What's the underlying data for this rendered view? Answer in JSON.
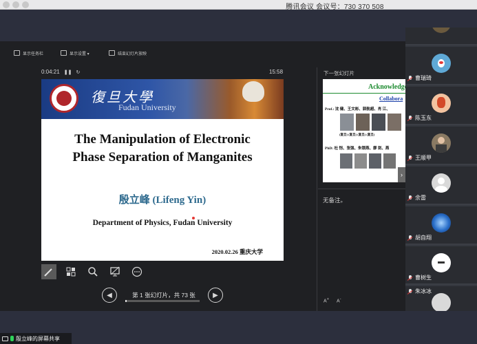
{
  "window": {
    "title": "腾讯会议 会议号：730 370 508"
  },
  "presenter": {
    "toolbar": {
      "show_taskbar": "显示任务栏",
      "display_settings": "显示设置 ▾",
      "end_slideshow": "结束幻灯片放映"
    },
    "elapsed_time": "0:04:21",
    "clock": "15:58",
    "next_slide_label": "下一张幻灯片",
    "notes": "无备注。",
    "font_increase": "A",
    "font_decrease": "A",
    "nav": {
      "slide_counter": "第 1 张幻灯片，共 73 张",
      "current": 1,
      "total": 73
    }
  },
  "slide": {
    "university_cn": "復旦大學",
    "university_en": "Fudan University",
    "title_line1": "The Manipulation of Electronic",
    "title_line2": "Phase Separation of Manganites",
    "author": "殷立峰 (Lifeng Yin)",
    "department": "Department of Physics, Fudan University",
    "date": "2020.02.26 重庆大学"
  },
  "next_slide": {
    "title": "Acknowledge",
    "subtitle": "Collabora",
    "prof_line": "Prof.: 沈 健、王文彬、郭航超、肖 江、",
    "prof_affiliations": "(复旦)   (复旦)   (复旦)   (复旦)",
    "phd_line": "PhD: 杜 恺、张强、朱银燕、廖 剑、燕"
  },
  "participants": [
    {
      "name": "",
      "avatar": "flower-photo"
    },
    {
      "name": "曹瑞琦",
      "avatar": "penguin-photo"
    },
    {
      "name": "陈玉东",
      "avatar": "cartoon-photo"
    },
    {
      "name": "王顺甲",
      "avatar": "person-photo"
    },
    {
      "name": "余雷",
      "avatar": "default-avatar"
    },
    {
      "name": "胡自翔",
      "avatar": "blue-photo"
    },
    {
      "name": "曹树生",
      "avatar": "logo-photo"
    },
    {
      "name": "朱冰冰",
      "avatar": "default-avatar"
    }
  ],
  "share_status": "殷立峰的屏幕共享",
  "colors": {
    "mic_muted": "#e23838",
    "mic_active": "#2fd35a",
    "ack_green": "#1b8a2e",
    "author_blue": "#2e6a8e"
  }
}
